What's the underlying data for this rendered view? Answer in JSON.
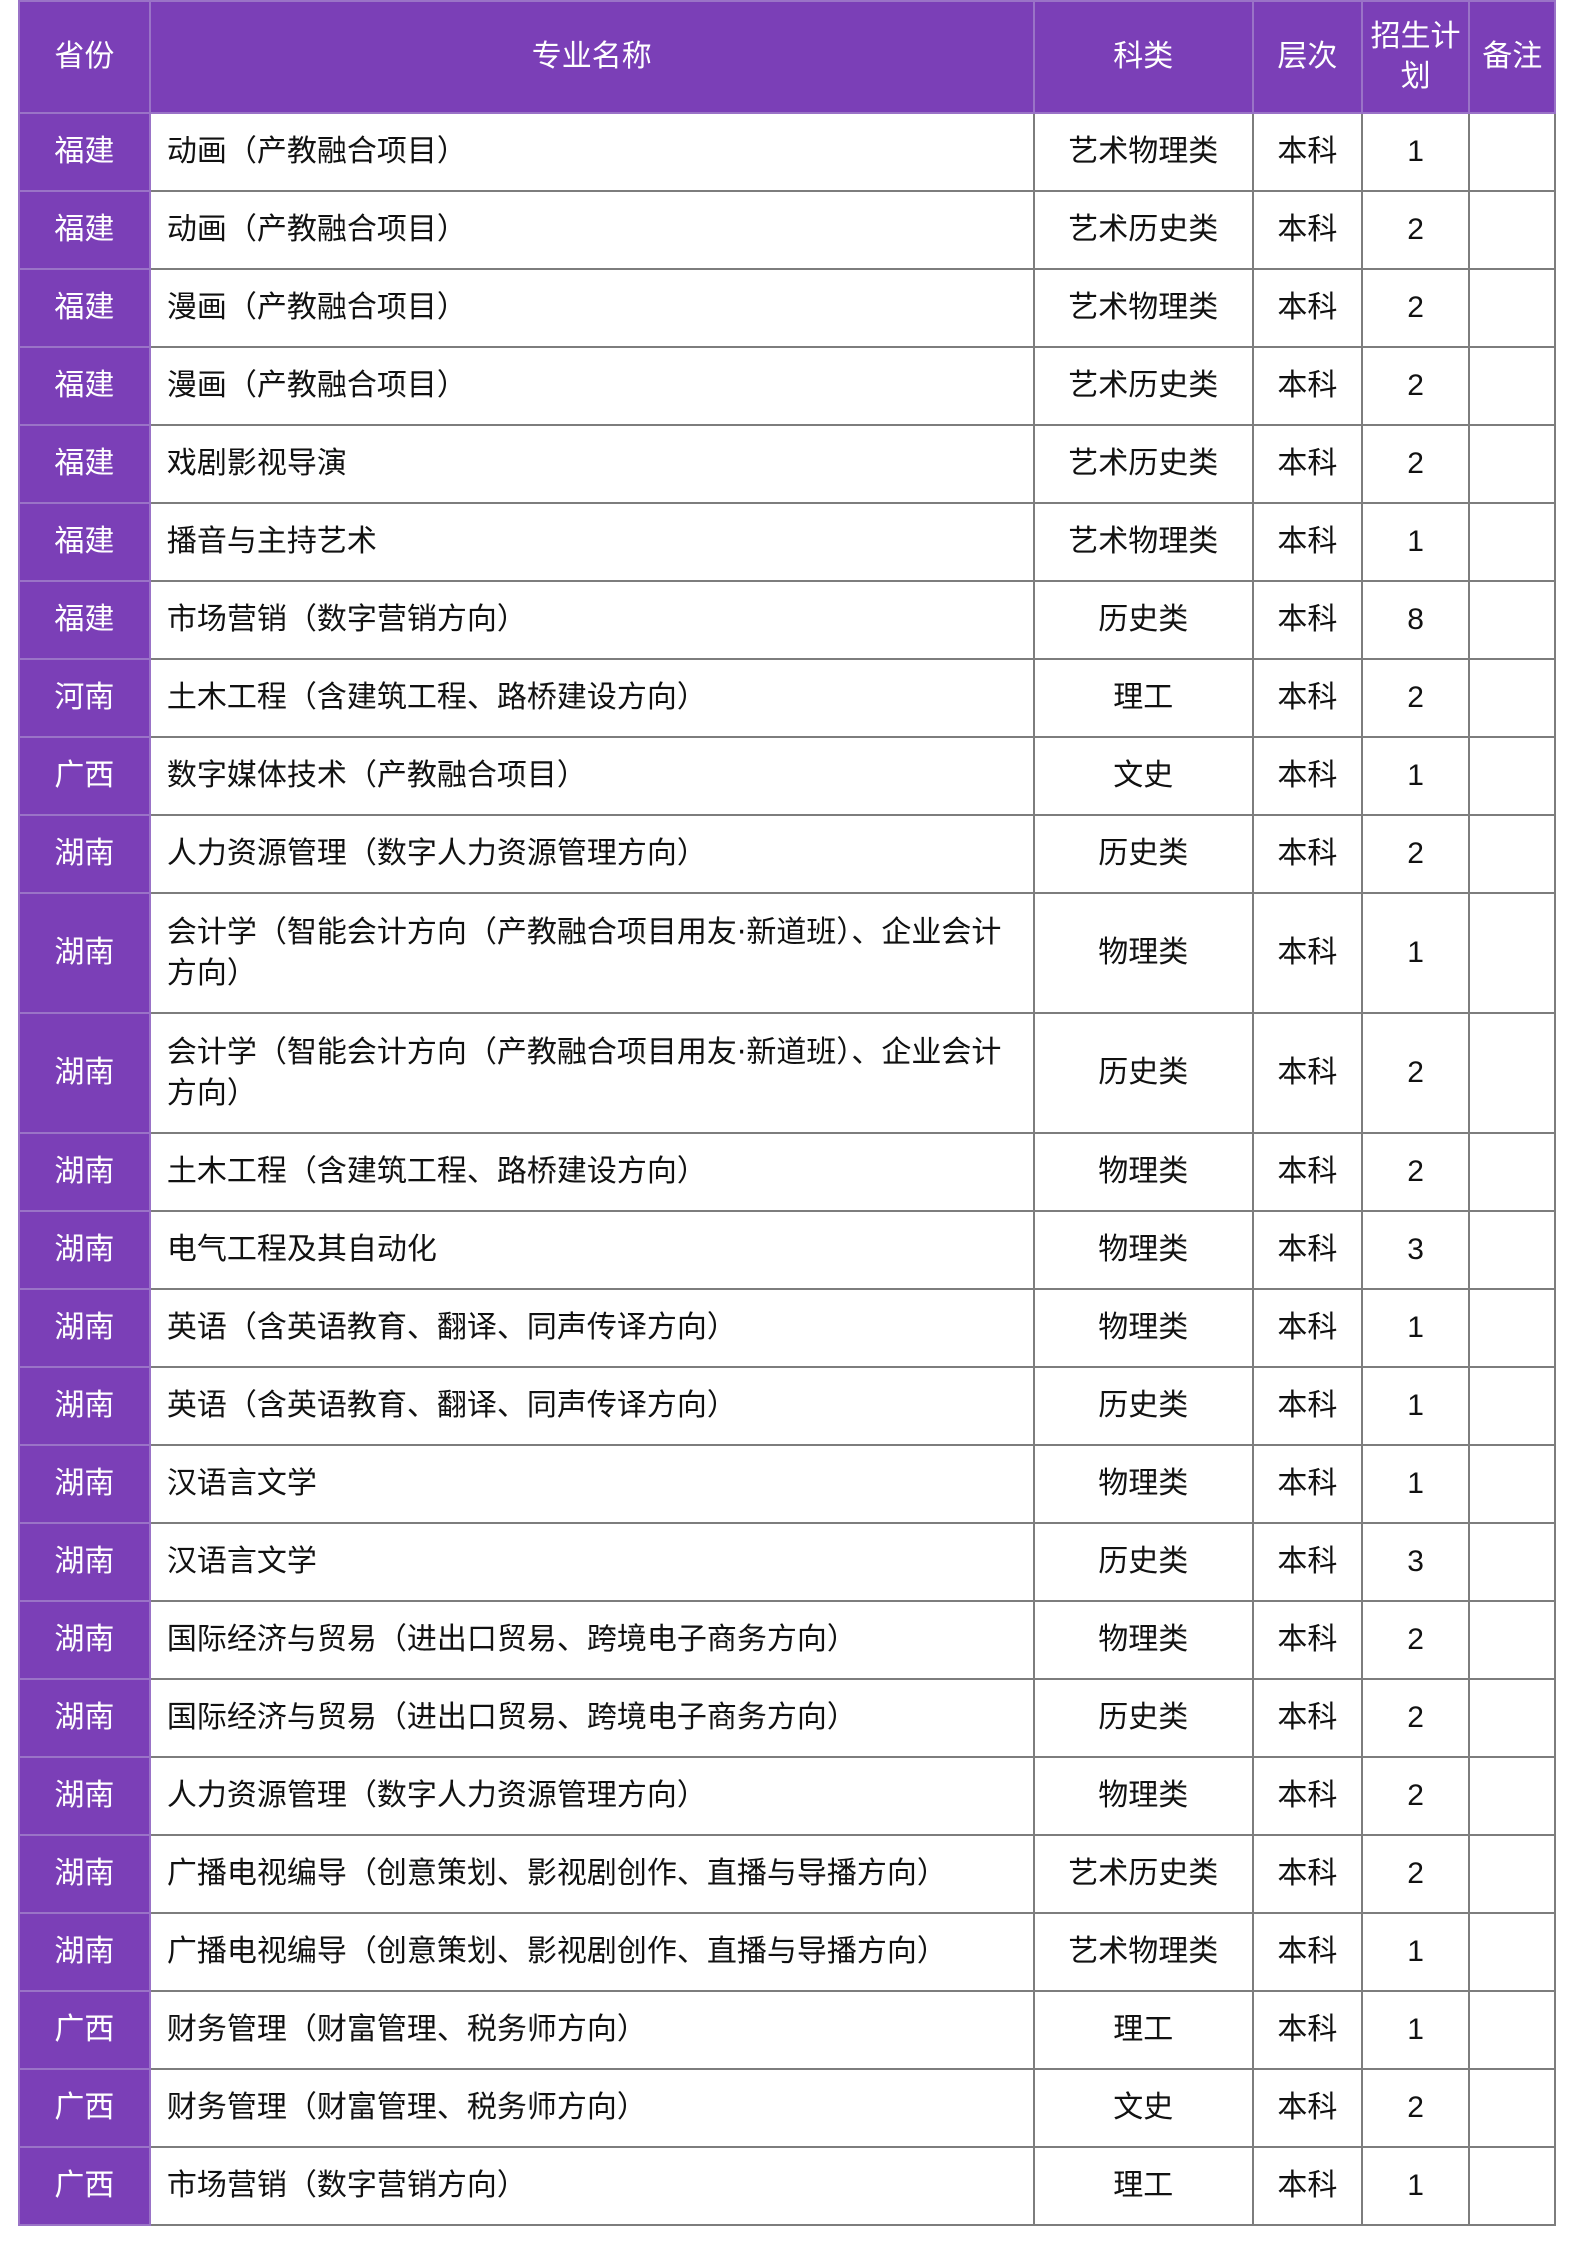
{
  "table": {
    "headers": {
      "province": "省份",
      "major": "专业名称",
      "category": "科类",
      "level": "层次",
      "plan": "招生计划",
      "remark": "备注"
    },
    "rows": [
      {
        "province": "福建",
        "major": "动画（产教融合项目）",
        "category": "艺术物理类",
        "level": "本科",
        "plan": "1",
        "remark": ""
      },
      {
        "province": "福建",
        "major": "动画（产教融合项目）",
        "category": "艺术历史类",
        "level": "本科",
        "plan": "2",
        "remark": ""
      },
      {
        "province": "福建",
        "major": "漫画（产教融合项目）",
        "category": "艺术物理类",
        "level": "本科",
        "plan": "2",
        "remark": ""
      },
      {
        "province": "福建",
        "major": "漫画（产教融合项目）",
        "category": "艺术历史类",
        "level": "本科",
        "plan": "2",
        "remark": ""
      },
      {
        "province": "福建",
        "major": "戏剧影视导演",
        "category": "艺术历史类",
        "level": "本科",
        "plan": "2",
        "remark": ""
      },
      {
        "province": "福建",
        "major": "播音与主持艺术",
        "category": "艺术物理类",
        "level": "本科",
        "plan": "1",
        "remark": ""
      },
      {
        "province": "福建",
        "major": "市场营销（数字营销方向）",
        "category": "历史类",
        "level": "本科",
        "plan": "8",
        "remark": ""
      },
      {
        "province": "河南",
        "major": "土木工程（含建筑工程、路桥建设方向）",
        "category": "理工",
        "level": "本科",
        "plan": "2",
        "remark": ""
      },
      {
        "province": "广西",
        "major": "数字媒体技术（产教融合项目）",
        "category": "文史",
        "level": "本科",
        "plan": "1",
        "remark": ""
      },
      {
        "province": "湖南",
        "major": "人力资源管理（数字人力资源管理方向）",
        "category": "历史类",
        "level": "本科",
        "plan": "2",
        "remark": ""
      },
      {
        "province": "湖南",
        "major": "会计学（智能会计方向（产教融合项目用友·新道班）、企业会计方向）",
        "category": "物理类",
        "level": "本科",
        "plan": "1",
        "remark": ""
      },
      {
        "province": "湖南",
        "major": "会计学（智能会计方向（产教融合项目用友·新道班）、企业会计方向）",
        "category": "历史类",
        "level": "本科",
        "plan": "2",
        "remark": ""
      },
      {
        "province": "湖南",
        "major": "土木工程（含建筑工程、路桥建设方向）",
        "category": "物理类",
        "level": "本科",
        "plan": "2",
        "remark": ""
      },
      {
        "province": "湖南",
        "major": "电气工程及其自动化",
        "category": "物理类",
        "level": "本科",
        "plan": "3",
        "remark": ""
      },
      {
        "province": "湖南",
        "major": "英语（含英语教育、翻译、同声传译方向）",
        "category": "物理类",
        "level": "本科",
        "plan": "1",
        "remark": ""
      },
      {
        "province": "湖南",
        "major": "英语（含英语教育、翻译、同声传译方向）",
        "category": "历史类",
        "level": "本科",
        "plan": "1",
        "remark": ""
      },
      {
        "province": "湖南",
        "major": "汉语言文学",
        "category": "物理类",
        "level": "本科",
        "plan": "1",
        "remark": ""
      },
      {
        "province": "湖南",
        "major": "汉语言文学",
        "category": "历史类",
        "level": "本科",
        "plan": "3",
        "remark": ""
      },
      {
        "province": "湖南",
        "major": "国际经济与贸易（进出口贸易、跨境电子商务方向）",
        "category": "物理类",
        "level": "本科",
        "plan": "2",
        "remark": ""
      },
      {
        "province": "湖南",
        "major": "国际经济与贸易（进出口贸易、跨境电子商务方向）",
        "category": "历史类",
        "level": "本科",
        "plan": "2",
        "remark": ""
      },
      {
        "province": "湖南",
        "major": "人力资源管理（数字人力资源管理方向）",
        "category": "物理类",
        "level": "本科",
        "plan": "2",
        "remark": ""
      },
      {
        "province": "湖南",
        "major": "广播电视编导（创意策划、影视剧创作、直播与导播方向）",
        "category": "艺术历史类",
        "level": "本科",
        "plan": "2",
        "remark": ""
      },
      {
        "province": "湖南",
        "major": "广播电视编导（创意策划、影视剧创作、直播与导播方向）",
        "category": "艺术物理类",
        "level": "本科",
        "plan": "1",
        "remark": ""
      },
      {
        "province": "广西",
        "major": "财务管理（财富管理、税务师方向）",
        "category": "理工",
        "level": "本科",
        "plan": "1",
        "remark": ""
      },
      {
        "province": "广西",
        "major": "财务管理（财富管理、税务师方向）",
        "category": "文史",
        "level": "本科",
        "plan": "2",
        "remark": ""
      },
      {
        "province": "广西",
        "major": "市场营销（数字营销方向）",
        "category": "理工",
        "level": "本科",
        "plan": "1",
        "remark": ""
      }
    ]
  }
}
